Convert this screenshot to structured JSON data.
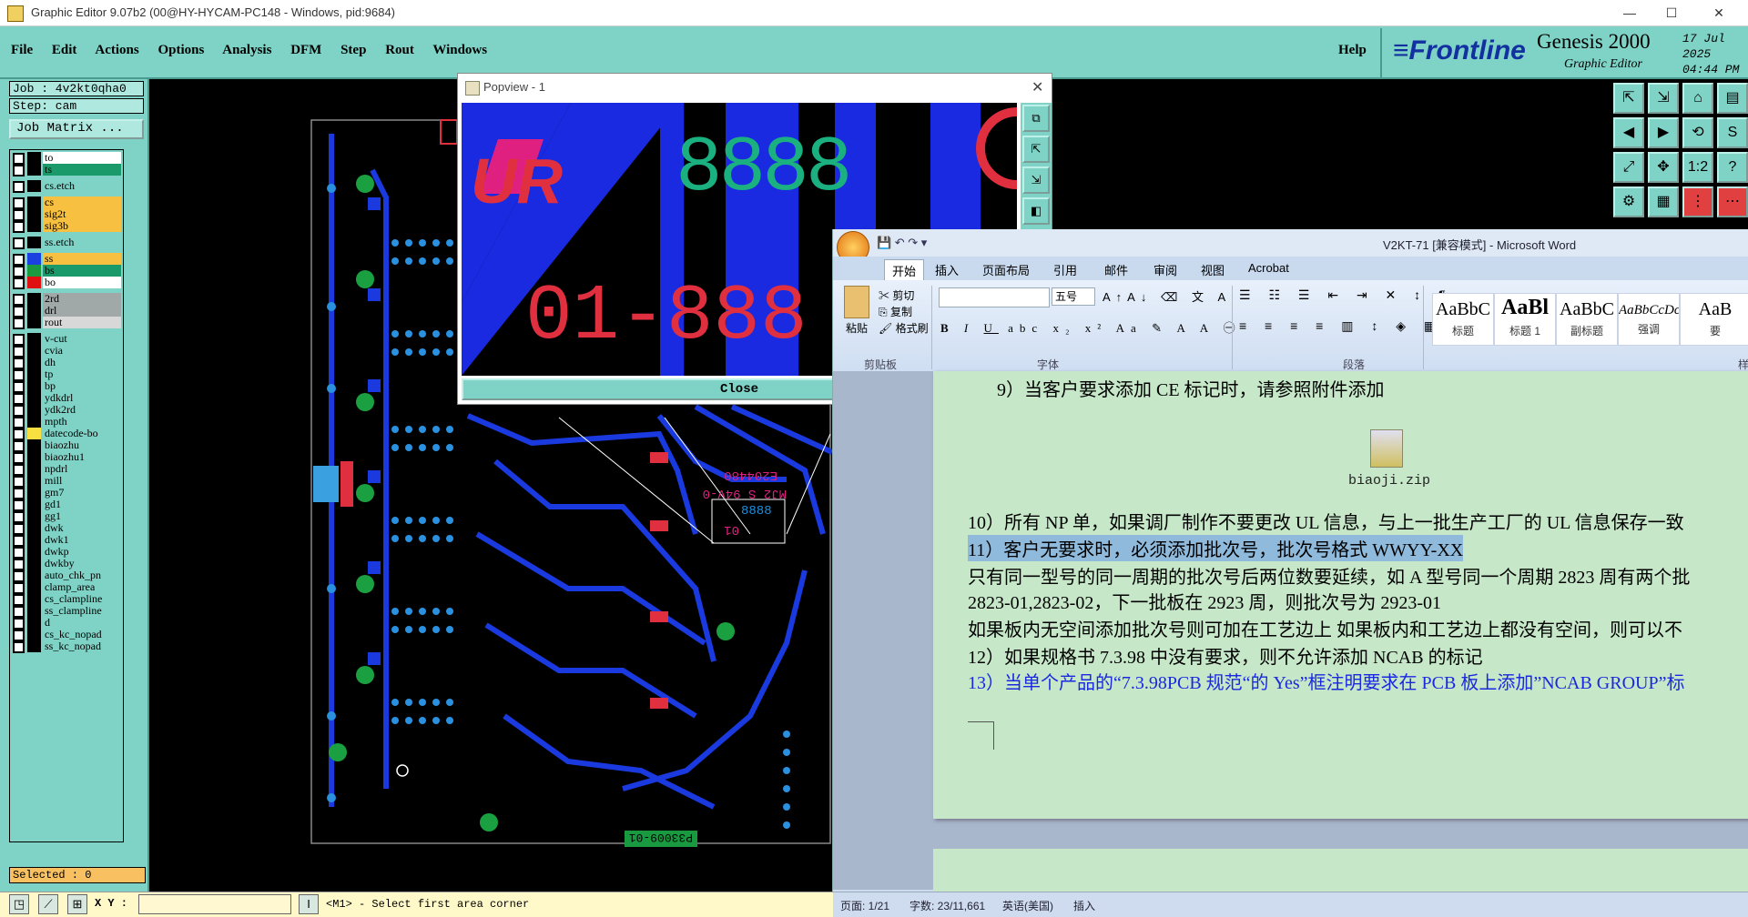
{
  "window": {
    "title": "Graphic Editor 9.07b2 (00@HY-HYCAM-PC148 - Windows, pid:9684)",
    "min": "—",
    "max": "☐",
    "close": "✕"
  },
  "menu": {
    "items": [
      "File",
      "Edit",
      "Actions",
      "Options",
      "Analysis",
      "DFM",
      "Step",
      "Rout",
      "Windows"
    ],
    "help": "Help"
  },
  "brand": {
    "logo": "≡Frontline",
    "product": "Genesis 2000",
    "sub": "Graphic Editor",
    "date": "17 Jul 2025",
    "time": "04:44 PM"
  },
  "job": {
    "job": "Job : 4v2kt0qha0",
    "step": "Step: cam",
    "matrix": "Job Matrix ..."
  },
  "layers": [
    {
      "name": "to",
      "color": "#000000",
      "bg": "#ffffff"
    },
    {
      "name": "ts",
      "color": "#000000",
      "bg": "#1a9a6a"
    },
    {
      "name": "cs.etch",
      "color": "#000000",
      "bg": "#7fd3c6"
    },
    {
      "name": "cs",
      "color": "#000000",
      "bg": "#f8c040"
    },
    {
      "name": "sig2t",
      "color": "#000000",
      "bg": "#f8c040"
    },
    {
      "name": "sig3b",
      "color": "#000000",
      "bg": "#f8c040"
    },
    {
      "name": "ss.etch",
      "color": "#000000",
      "bg": "#7fd3c6"
    },
    {
      "name": "ss",
      "color": "#1a40e0",
      "bg": "#f8c040"
    },
    {
      "name": "bs",
      "color": "#1a9a40",
      "bg": "#1a9a6a"
    },
    {
      "name": "bo",
      "color": "#e01010",
      "bg": "#ffffff"
    },
    {
      "name": "2rd",
      "color": "#000000",
      "bg": "#a0a8a8"
    },
    {
      "name": "drl",
      "color": "#000000",
      "bg": "#a0a8a8"
    },
    {
      "name": "rout",
      "color": "#000000",
      "bg": "#d8d8d8"
    },
    {
      "name": "v-cut",
      "color": "#000000",
      "bg": "#7fd3c6"
    },
    {
      "name": "cvia",
      "color": "#000000",
      "bg": "#7fd3c6"
    },
    {
      "name": "dh",
      "color": "#000000",
      "bg": "#7fd3c6"
    },
    {
      "name": "tp",
      "color": "#000000",
      "bg": "#7fd3c6"
    },
    {
      "name": "bp",
      "color": "#000000",
      "bg": "#7fd3c6"
    },
    {
      "name": "ydkdrl",
      "color": "#000000",
      "bg": "#7fd3c6"
    },
    {
      "name": "ydk2rd",
      "color": "#000000",
      "bg": "#7fd3c6"
    },
    {
      "name": "mpth",
      "color": "#000000",
      "bg": "#7fd3c6"
    },
    {
      "name": "datecode-bo",
      "color": "#f8e040",
      "bg": "#7fd3c6"
    },
    {
      "name": "biaozhu",
      "color": "#000000",
      "bg": "#7fd3c6"
    },
    {
      "name": "biaozhu1",
      "color": "#000000",
      "bg": "#7fd3c6"
    },
    {
      "name": "npdrl",
      "color": "#000000",
      "bg": "#7fd3c6"
    },
    {
      "name": "mill",
      "color": "#000000",
      "bg": "#7fd3c6"
    },
    {
      "name": "gm7",
      "color": "#000000",
      "bg": "#7fd3c6"
    },
    {
      "name": "gd1",
      "color": "#000000",
      "bg": "#7fd3c6"
    },
    {
      "name": "gg1",
      "color": "#000000",
      "bg": "#7fd3c6"
    },
    {
      "name": "dwk",
      "color": "#000000",
      "bg": "#7fd3c6"
    },
    {
      "name": "dwk1",
      "color": "#000000",
      "bg": "#7fd3c6"
    },
    {
      "name": "dwkp",
      "color": "#000000",
      "bg": "#7fd3c6"
    },
    {
      "name": "dwkby",
      "color": "#000000",
      "bg": "#7fd3c6"
    },
    {
      "name": "auto_chk_pn",
      "color": "#000000",
      "bg": "#7fd3c6"
    },
    {
      "name": "clamp_area",
      "color": "#000000",
      "bg": "#7fd3c6"
    },
    {
      "name": "cs_clampline",
      "color": "#000000",
      "bg": "#7fd3c6"
    },
    {
      "name": "ss_clampline",
      "color": "#000000",
      "bg": "#7fd3c6"
    },
    {
      "name": "d",
      "color": "#000000",
      "bg": "#7fd3c6"
    },
    {
      "name": "cs_kc_nopad",
      "color": "#000000",
      "bg": "#7fd3c6"
    },
    {
      "name": "ss_kc_nopad",
      "color": "#000000",
      "bg": "#7fd3c6"
    }
  ],
  "status": {
    "selected": "Selected : 0",
    "xy_label": "X Y :",
    "message": "<M1> - Select first area corner"
  },
  "pcb": {
    "label": "P33009-01",
    "marking_1": "E204480",
    "marking_2": "MJ2 S 94V-0",
    "marking_3": "8888",
    "marking_4": "01"
  },
  "popview": {
    "title": "Popview - 1",
    "close": "Close",
    "text_top": "8888",
    "text_bottom": "01-888"
  },
  "word": {
    "title": "V2KT-71 [兼容模式] - Microsoft Word",
    "tabs": [
      "开始",
      "插入",
      "页面布局",
      "引用",
      "邮件",
      "审阅",
      "视图",
      "Acrobat"
    ],
    "clipboard": {
      "paste": "粘贴",
      "cut": "剪切",
      "copy": "复制",
      "format": "格式刷",
      "group": "剪贴板"
    },
    "font": {
      "size": "五号",
      "group": "字体"
    },
    "paragraph_group": "段落",
    "styles": [
      {
        "preview": "AaBbC",
        "name": "标题"
      },
      {
        "preview": "AaBl",
        "name": "标题 1"
      },
      {
        "preview": "AaBbC",
        "name": "副标题"
      },
      {
        "preview": "AaBbCcDc",
        "name": "强调"
      },
      {
        "preview": "AaB",
        "name": "要"
      }
    ],
    "styles_group": "样",
    "paragraphs": {
      "p9": "9）当客户要求添加 CE 标记时，请参照附件添加",
      "attachment": "biaoji.zip",
      "p10": "10）所有 NP 单，如果调厂制作不要更改 UL 信息，与上一批生产工厂的 UL 信息保存一致",
      "p11": "11）客户无要求时，必须添加批次号，批次号格式 WWYY-XX",
      "p11b": "只有同一型号的同一周期的批次号后两位数要延续，如 A 型号同一个周期 2823 周有两个批",
      "p11c": "2823-01,2823-02，下一批板在 2923 周，则批次号为 2923-01",
      "p11d": "如果板内无空间添加批次号则可加在工艺边上 如果板内和工艺边上都没有空间，则可以不",
      "p12": "12）如果规格书 7.3.98 中没有要求，则不允许添加 NCAB 的标记",
      "p13": "13）当单个产品的“7.3.98PCB 规范“的 Yes”框注明要求在 PCB 板上添加”NCAB GROUP”标"
    },
    "status": {
      "page": "页面: 1/21",
      "words": "字数: 23/11,661",
      "lang": "英语(美国)",
      "mode": "插入"
    }
  }
}
